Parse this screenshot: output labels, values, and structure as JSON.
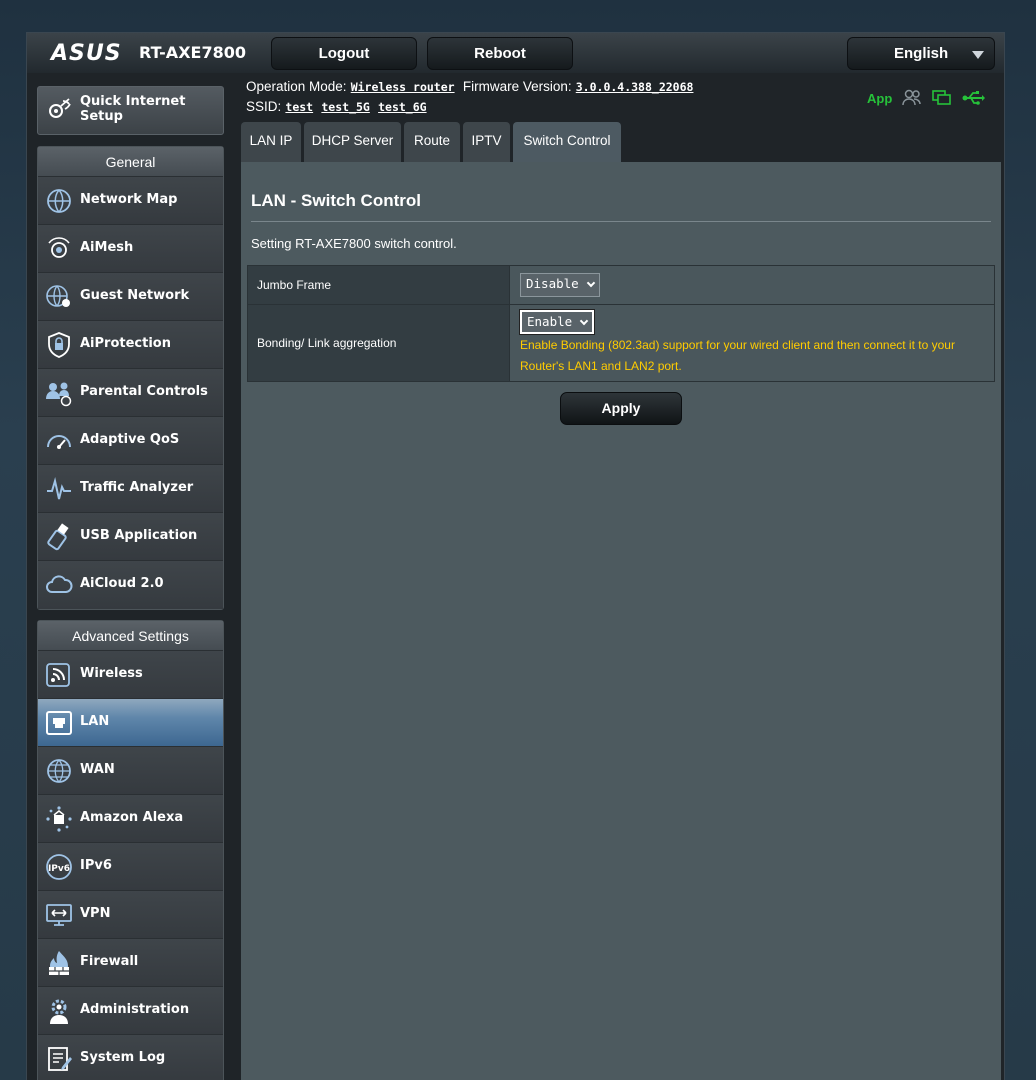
{
  "header": {
    "brand": "ASUS",
    "model": "RT-AXE7800",
    "logout_label": "Logout",
    "reboot_label": "Reboot",
    "language": "English"
  },
  "info": {
    "operation_mode_label": "Operation Mode:",
    "operation_mode_value": "Wireless router",
    "firmware_label": "Firmware Version:",
    "firmware_value": "3.0.0.4.388_22068",
    "ssid_label": "SSID:",
    "ssids": [
      "test",
      "test_5G",
      "test_6G"
    ],
    "app_label": "App"
  },
  "sidebar": {
    "quick_setup": "Quick Internet Setup",
    "general": {
      "heading": "General",
      "items": [
        {
          "label": "Network Map",
          "icon": "network-map-icon"
        },
        {
          "label": "AiMesh",
          "icon": "aimesh-icon"
        },
        {
          "label": "Guest Network",
          "icon": "guest-network-icon"
        },
        {
          "label": "AiProtection",
          "icon": "aiprotection-icon"
        },
        {
          "label": "Parental Controls",
          "icon": "parental-controls-icon"
        },
        {
          "label": "Adaptive QoS",
          "icon": "adaptive-qos-icon"
        },
        {
          "label": "Traffic Analyzer",
          "icon": "traffic-analyzer-icon"
        },
        {
          "label": "USB Application",
          "icon": "usb-application-icon"
        },
        {
          "label": "AiCloud 2.0",
          "icon": "aicloud-icon"
        }
      ]
    },
    "advanced": {
      "heading": "Advanced Settings",
      "items": [
        {
          "label": "Wireless",
          "icon": "wireless-icon"
        },
        {
          "label": "LAN",
          "icon": "lan-icon",
          "active": true
        },
        {
          "label": "WAN",
          "icon": "wan-icon"
        },
        {
          "label": "Amazon Alexa",
          "icon": "alexa-icon"
        },
        {
          "label": "IPv6",
          "icon": "ipv6-icon"
        },
        {
          "label": "VPN",
          "icon": "vpn-icon"
        },
        {
          "label": "Firewall",
          "icon": "firewall-icon"
        },
        {
          "label": "Administration",
          "icon": "administration-icon"
        },
        {
          "label": "System Log",
          "icon": "system-log-icon"
        }
      ]
    }
  },
  "tabs": [
    "LAN IP",
    "DHCP Server",
    "Route",
    "IPTV",
    "Switch Control"
  ],
  "active_tab": "Switch Control",
  "content": {
    "title": "LAN - Switch Control",
    "description": "Setting RT-AXE7800 switch control.",
    "rows": [
      {
        "label": "Jumbo Frame",
        "value": "Disable"
      },
      {
        "label": "Bonding/ Link aggregation",
        "value": "Enable",
        "note": "Enable Bonding (802.3ad) support for your wired client and then connect it to your Router's LAN1 and LAN2 port."
      }
    ],
    "apply_label": "Apply"
  },
  "colors": {
    "accent_active": "#3d6791",
    "note_text": "#ffcc00",
    "status_green": "#26c23a"
  }
}
